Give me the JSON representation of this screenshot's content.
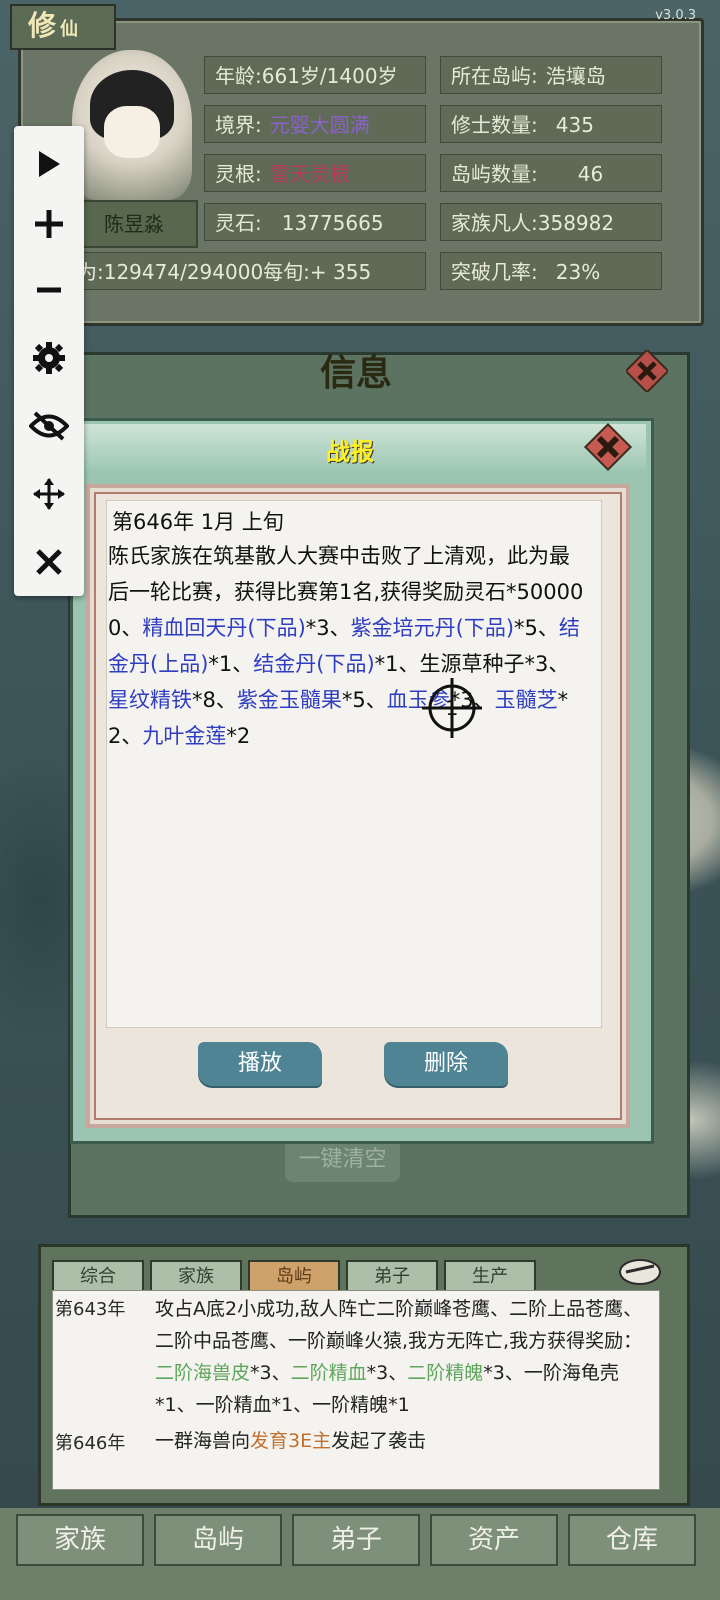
{
  "app": {
    "title_main": "修",
    "title_sub": "仙",
    "version": "v3.0.3"
  },
  "status": {
    "age_label": "年龄:",
    "age_value": "661岁/1400岁",
    "island_label": "所在岛屿:",
    "island_value": "浩壤岛",
    "realm_label": "境界:",
    "realm_value": "元婴大圆满",
    "cultivators_label": "修士数量:",
    "cultivators_value": "435",
    "root_label": "灵根:",
    "root_value": "雷天灵根",
    "islands_label": "岛屿数量:",
    "islands_value": "46",
    "stones_label": "灵石:",
    "stones_value": "13775665",
    "mortals_label": "家族凡人:",
    "mortals_value": "358982",
    "cultivation_value": "修为:129474/294000每旬:+ 355",
    "breakthrough_label": "突破几率:",
    "breakthrough_value": "23%",
    "character_name": "陈昱淼"
  },
  "toolbar": {
    "items": [
      "play",
      "plus",
      "minus",
      "settings",
      "hide",
      "move",
      "close"
    ]
  },
  "info_panel": {
    "title": "信息",
    "clear_all": "一键清空"
  },
  "report": {
    "title": "战报",
    "date": "第646年 1月 上旬",
    "text_1": "陈氏家族在筑基散人大赛中击败了上清观，此为最后一轮比赛，获得比赛第1名,获得奖励灵石*500000、",
    "item_1": "精血回天丹(下品)",
    "qty_1": "*3、",
    "item_2": "紫金培元丹(下品)",
    "qty_2": "*5、",
    "item_3": "结金丹(上品)",
    "qty_3": "*1、",
    "item_4": "结金丹(下品)",
    "qty_4": "*1、生源草种子*3、",
    "item_5": "星纹精铁",
    "qty_5": "*8、",
    "item_6": "紫金玉髓果",
    "qty_6": "*5、",
    "item_7": "血玉参",
    "qty_7": "*3、",
    "item_8": "玉髓芝",
    "qty_8": "*2、",
    "item_9": "九叶金莲",
    "qty_9": "*2",
    "play_button": "播放",
    "delete_button": "删除",
    "page_marker": "1"
  },
  "log": {
    "tabs": [
      "综合",
      "家族",
      "岛屿",
      "弟子",
      "生产"
    ],
    "active_tab": 2,
    "entries": [
      {
        "year": "第643年",
        "part_1": "攻占A底2小成功,敌人阵亡二阶巅峰苍鹰、二阶上品苍鹰、二阶中品苍鹰、一阶巅峰火猿,我方无阵亡,我方获得奖励：",
        "g1": "二阶海兽皮",
        "t1": "*3、",
        "g2": "二阶精血",
        "t2": "*3、",
        "g3": "二阶精魄",
        "t3": "*3、一阶海龟壳*1、一阶精血*1、一阶精魄*1"
      },
      {
        "year": "第646年",
        "part_1": "一群海兽向",
        "o1": "发育3E主",
        "part_2": "发起了袭击"
      }
    ]
  },
  "nav": {
    "items": [
      "家族",
      "岛屿",
      "弟子",
      "资产",
      "仓库"
    ]
  },
  "colors": {
    "item_blue": "#2f3ec0",
    "title_yellow": "#fff023",
    "teal_button": "#4f8494"
  }
}
